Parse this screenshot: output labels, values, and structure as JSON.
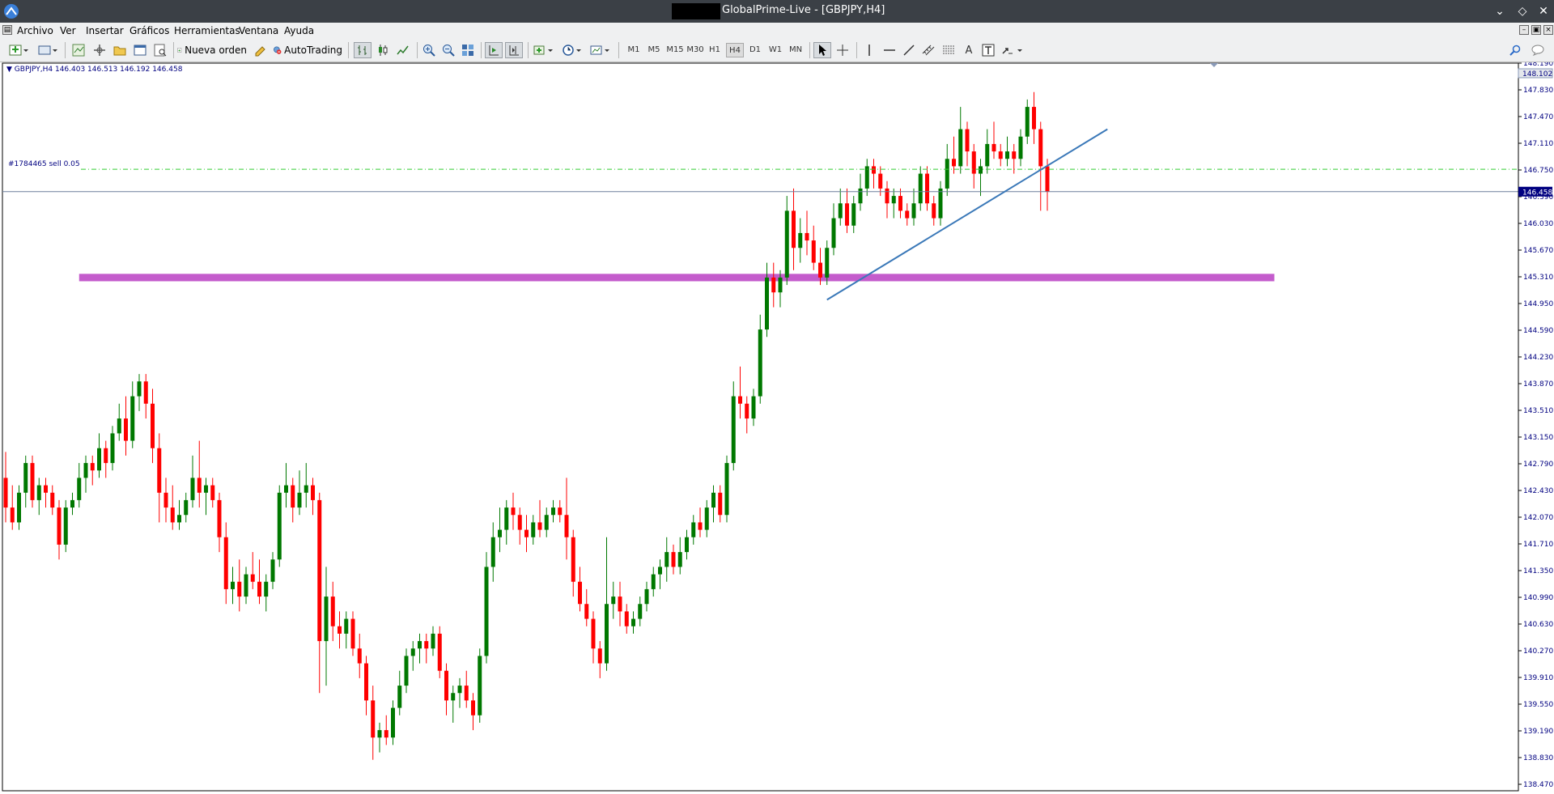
{
  "window": {
    "title": "GlobalPrime-Live - [GBPJPY,H4]"
  },
  "menu": {
    "items": [
      "Archivo",
      "Ver",
      "Insertar",
      "Gráficos",
      "Herramientas",
      "Ventana",
      "Ayuda"
    ]
  },
  "toolbar": {
    "new_order_label": "Nueva orden",
    "autotrading_label": "AutoTrading",
    "timeframes": [
      "M1",
      "M5",
      "M15",
      "M30",
      "H1",
      "H4",
      "D1",
      "W1",
      "MN"
    ],
    "active_timeframe": "H4"
  },
  "chart": {
    "header": "GBPJPY,H4  146.403 146.513 146.192 146.458",
    "order_label": "#1784465 sell 0.05",
    "colors": {
      "bull": "#007800",
      "bear": "#ff0000",
      "trendline": "#3a78b8",
      "zone": "#c45ccc",
      "order_line": "#33cc33",
      "bid_line": "#6d7f9c",
      "axis": "#000080",
      "price_label_bg": "#000080"
    }
  },
  "chart_data": {
    "type": "candlestick",
    "symbol": "GBPJPY",
    "timeframe": "H4",
    "ylim": [
      138.47,
      148.19
    ],
    "y_ticks": [
      "148.190",
      "147.830",
      "147.470",
      "147.110",
      "146.750",
      "146.390",
      "146.030",
      "145.670",
      "145.310",
      "144.950",
      "144.590",
      "144.230",
      "143.870",
      "143.510",
      "143.150",
      "142.790",
      "142.430",
      "142.070",
      "141.710",
      "141.350",
      "140.990",
      "140.630",
      "140.270",
      "139.910",
      "139.550",
      "139.190",
      "138.830",
      "138.470"
    ],
    "current_price": "146.458",
    "top_price_label": "148.102",
    "ohlc": [
      [
        142.6,
        142.95,
        142.0,
        142.2
      ],
      [
        142.2,
        142.5,
        141.9,
        142.0
      ],
      [
        142.0,
        142.5,
        141.9,
        142.4
      ],
      [
        142.4,
        142.9,
        142.2,
        142.8
      ],
      [
        142.8,
        142.9,
        142.2,
        142.3
      ],
      [
        142.3,
        142.6,
        142.1,
        142.5
      ],
      [
        142.5,
        142.6,
        142.2,
        142.4
      ],
      [
        142.4,
        142.5,
        142.1,
        142.2
      ],
      [
        142.2,
        142.3,
        141.5,
        141.7
      ],
      [
        141.7,
        142.3,
        141.6,
        142.2
      ],
      [
        142.2,
        142.4,
        142.1,
        142.3
      ],
      [
        142.3,
        142.8,
        142.2,
        142.6
      ],
      [
        142.6,
        142.9,
        142.4,
        142.8
      ],
      [
        142.8,
        142.9,
        142.5,
        142.7
      ],
      [
        142.7,
        143.2,
        142.6,
        143.0
      ],
      [
        143.0,
        143.1,
        142.6,
        142.8
      ],
      [
        142.8,
        143.3,
        142.7,
        143.2
      ],
      [
        143.2,
        143.6,
        143.1,
        143.4
      ],
      [
        143.4,
        143.7,
        142.9,
        143.1
      ],
      [
        143.1,
        143.9,
        143.0,
        143.7
      ],
      [
        143.7,
        144.0,
        143.5,
        143.9
      ],
      [
        143.9,
        144.0,
        143.4,
        143.6
      ],
      [
        143.6,
        143.8,
        142.8,
        143.0
      ],
      [
        143.0,
        143.2,
        142.0,
        142.4
      ],
      [
        142.4,
        142.6,
        142.0,
        142.2
      ],
      [
        142.2,
        142.5,
        141.9,
        142.0
      ],
      [
        142.0,
        142.3,
        141.9,
        142.1
      ],
      [
        142.1,
        142.4,
        142.0,
        142.3
      ],
      [
        142.3,
        142.9,
        142.2,
        142.6
      ],
      [
        142.6,
        143.1,
        142.2,
        142.4
      ],
      [
        142.4,
        142.6,
        142.1,
        142.5
      ],
      [
        142.5,
        142.6,
        142.2,
        142.3
      ],
      [
        142.3,
        142.4,
        141.6,
        141.8
      ],
      [
        141.8,
        142.0,
        140.9,
        141.1
      ],
      [
        141.1,
        141.4,
        140.9,
        141.2
      ],
      [
        141.2,
        141.5,
        140.8,
        141.0
      ],
      [
        141.0,
        141.4,
        140.9,
        141.3
      ],
      [
        141.3,
        141.6,
        141.1,
        141.2
      ],
      [
        141.2,
        141.5,
        140.9,
        141.0
      ],
      [
        141.0,
        141.3,
        140.8,
        141.2
      ],
      [
        141.2,
        141.6,
        141.1,
        141.5
      ],
      [
        141.5,
        142.5,
        141.4,
        142.4
      ],
      [
        142.4,
        142.8,
        142.2,
        142.5
      ],
      [
        142.5,
        142.6,
        142.0,
        142.2
      ],
      [
        142.2,
        142.7,
        142.1,
        142.4
      ],
      [
        142.4,
        142.8,
        142.2,
        142.5
      ],
      [
        142.5,
        142.6,
        142.1,
        142.3
      ],
      [
        142.3,
        142.4,
        139.7,
        140.4
      ],
      [
        140.4,
        141.4,
        139.8,
        141.0
      ],
      [
        141.0,
        141.2,
        140.4,
        140.6
      ],
      [
        140.6,
        140.8,
        140.3,
        140.5
      ],
      [
        140.5,
        140.8,
        140.3,
        140.7
      ],
      [
        140.7,
        140.8,
        140.2,
        140.3
      ],
      [
        140.3,
        140.5,
        139.9,
        140.1
      ],
      [
        140.1,
        140.2,
        139.4,
        139.6
      ],
      [
        139.6,
        139.8,
        138.8,
        139.1
      ],
      [
        139.1,
        139.3,
        138.9,
        139.2
      ],
      [
        139.2,
        139.4,
        139.0,
        139.1
      ],
      [
        139.1,
        139.6,
        139.0,
        139.5
      ],
      [
        139.5,
        140.0,
        139.4,
        139.8
      ],
      [
        139.8,
        140.3,
        139.7,
        140.2
      ],
      [
        140.2,
        140.4,
        140.0,
        140.3
      ],
      [
        140.3,
        140.5,
        140.1,
        140.4
      ],
      [
        140.4,
        140.5,
        140.1,
        140.3
      ],
      [
        140.3,
        140.6,
        140.2,
        140.5
      ],
      [
        140.5,
        140.6,
        139.9,
        140.0
      ],
      [
        140.0,
        140.1,
        139.4,
        139.6
      ],
      [
        139.6,
        139.8,
        139.3,
        139.7
      ],
      [
        139.7,
        139.9,
        139.5,
        139.8
      ],
      [
        139.8,
        140.0,
        139.5,
        139.6
      ],
      [
        139.6,
        139.7,
        139.2,
        139.4
      ],
      [
        139.4,
        140.3,
        139.3,
        140.2
      ],
      [
        140.2,
        141.6,
        140.1,
        141.4
      ],
      [
        141.4,
        142.0,
        141.2,
        141.8
      ],
      [
        141.8,
        142.2,
        141.6,
        141.9
      ],
      [
        141.9,
        142.3,
        141.7,
        142.2
      ],
      [
        142.2,
        142.4,
        141.9,
        142.1
      ],
      [
        142.1,
        142.2,
        141.7,
        141.9
      ],
      [
        141.9,
        142.1,
        141.6,
        141.8
      ],
      [
        141.8,
        142.1,
        141.7,
        142.0
      ],
      [
        142.0,
        142.3,
        141.8,
        141.9
      ],
      [
        141.9,
        142.2,
        141.8,
        142.1
      ],
      [
        142.1,
        142.3,
        142.0,
        142.2
      ],
      [
        142.2,
        142.3,
        142.0,
        142.1
      ],
      [
        142.1,
        142.6,
        141.5,
        141.8
      ],
      [
        141.8,
        141.9,
        141.0,
        141.2
      ],
      [
        141.2,
        141.4,
        140.8,
        140.9
      ],
      [
        140.9,
        141.1,
        140.6,
        140.7
      ],
      [
        140.7,
        140.8,
        140.1,
        140.3
      ],
      [
        140.3,
        140.4,
        139.9,
        140.1
      ],
      [
        140.1,
        141.8,
        140.0,
        140.9
      ],
      [
        140.9,
        141.2,
        140.7,
        141.0
      ],
      [
        141.0,
        141.2,
        140.6,
        140.8
      ],
      [
        140.8,
        140.9,
        140.5,
        140.6
      ],
      [
        140.6,
        140.8,
        140.5,
        140.7
      ],
      [
        140.7,
        141.0,
        140.6,
        140.9
      ],
      [
        140.9,
        141.2,
        140.8,
        141.1
      ],
      [
        141.1,
        141.4,
        141.0,
        141.3
      ],
      [
        141.3,
        141.5,
        141.1,
        141.4
      ],
      [
        141.4,
        141.8,
        141.2,
        141.6
      ],
      [
        141.6,
        141.7,
        141.3,
        141.4
      ],
      [
        141.4,
        141.8,
        141.3,
        141.6
      ],
      [
        141.6,
        141.9,
        141.5,
        141.8
      ],
      [
        141.8,
        142.1,
        141.7,
        142.0
      ],
      [
        142.0,
        142.2,
        141.8,
        141.9
      ],
      [
        141.9,
        142.3,
        141.8,
        142.2
      ],
      [
        142.2,
        142.5,
        142.0,
        142.4
      ],
      [
        142.4,
        142.5,
        142.0,
        142.1
      ],
      [
        142.1,
        142.9,
        142.0,
        142.8
      ],
      [
        142.8,
        143.9,
        142.7,
        143.7
      ],
      [
        143.7,
        144.1,
        143.4,
        143.6
      ],
      [
        143.6,
        143.7,
        143.2,
        143.4
      ],
      [
        143.4,
        143.8,
        143.3,
        143.7
      ],
      [
        143.7,
        144.8,
        143.6,
        144.6
      ],
      [
        144.6,
        145.5,
        144.5,
        145.3
      ],
      [
        145.3,
        145.5,
        144.9,
        145.1
      ],
      [
        145.1,
        145.4,
        144.9,
        145.3
      ],
      [
        145.3,
        146.4,
        145.2,
        146.2
      ],
      [
        146.2,
        146.5,
        145.4,
        145.7
      ],
      [
        145.7,
        146.1,
        145.5,
        145.9
      ],
      [
        145.9,
        146.2,
        145.6,
        145.8
      ],
      [
        145.8,
        146.0,
        145.4,
        145.5
      ],
      [
        145.5,
        145.7,
        145.2,
        145.3
      ],
      [
        145.3,
        145.8,
        145.2,
        145.7
      ],
      [
        145.7,
        146.3,
        145.6,
        146.1
      ],
      [
        146.1,
        146.5,
        146.0,
        146.3
      ],
      [
        146.3,
        146.5,
        145.9,
        146.0
      ],
      [
        146.0,
        146.4,
        145.9,
        146.3
      ],
      [
        146.3,
        146.7,
        146.2,
        146.5
      ],
      [
        146.5,
        146.9,
        146.4,
        146.8
      ],
      [
        146.8,
        146.9,
        146.5,
        146.7
      ],
      [
        146.7,
        146.8,
        146.4,
        146.5
      ],
      [
        146.5,
        146.6,
        146.1,
        146.3
      ],
      [
        146.3,
        146.5,
        146.1,
        146.4
      ],
      [
        146.4,
        146.5,
        146.1,
        146.2
      ],
      [
        146.2,
        146.3,
        146.0,
        146.1
      ],
      [
        146.1,
        146.5,
        146.0,
        146.3
      ],
      [
        146.3,
        146.8,
        146.2,
        146.7
      ],
      [
        146.7,
        146.8,
        146.2,
        146.3
      ],
      [
        146.3,
        146.4,
        146.0,
        146.1
      ],
      [
        146.1,
        146.6,
        146.0,
        146.5
      ],
      [
        146.5,
        147.1,
        146.4,
        146.9
      ],
      [
        146.9,
        147.2,
        146.7,
        146.8
      ],
      [
        146.8,
        147.6,
        146.7,
        147.3
      ],
      [
        147.3,
        147.4,
        146.8,
        147.0
      ],
      [
        147.0,
        147.1,
        146.5,
        146.7
      ],
      [
        146.7,
        146.9,
        146.4,
        146.8
      ],
      [
        146.8,
        147.3,
        146.7,
        147.1
      ],
      [
        147.1,
        147.4,
        146.9,
        147.0
      ],
      [
        147.0,
        147.1,
        146.8,
        146.9
      ],
      [
        146.9,
        147.2,
        146.8,
        147.0
      ],
      [
        147.0,
        147.1,
        146.7,
        146.9
      ],
      [
        146.9,
        147.3,
        146.8,
        147.2
      ],
      [
        147.2,
        147.7,
        147.1,
        147.6
      ],
      [
        147.6,
        147.8,
        147.1,
        147.3
      ],
      [
        147.3,
        147.4,
        146.2,
        146.8
      ],
      [
        146.8,
        146.9,
        146.2,
        146.458
      ]
    ],
    "trendline": {
      "start": [
        123,
        145.0
      ],
      "end": [
        165,
        147.3
      ]
    },
    "zone": {
      "from_index": 11,
      "to_index": 190,
      "low": 145.25,
      "high": 145.35
    },
    "order_price": 146.76
  }
}
